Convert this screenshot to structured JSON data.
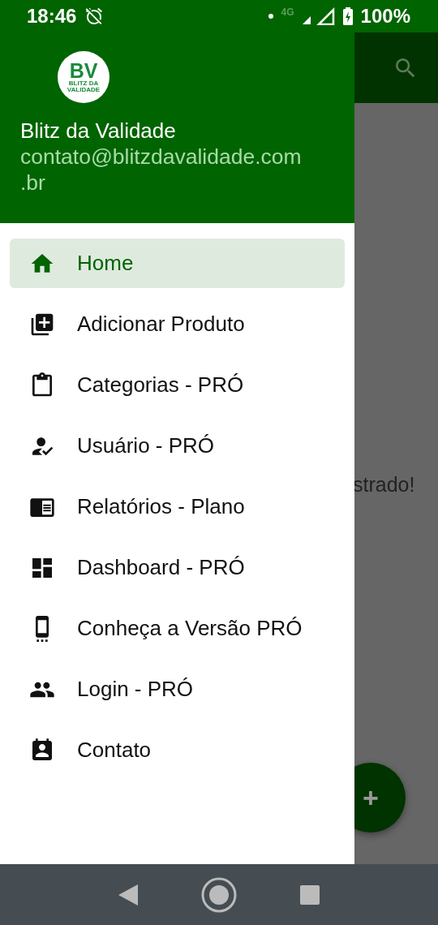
{
  "status_bar": {
    "time": "18:46",
    "network": "4G",
    "battery": "100%"
  },
  "drawer": {
    "logo": {
      "letters": "BV",
      "tagline": "BLITZ DA VALIDADE"
    },
    "title": "Blitz da Validade",
    "email": "contato@blitzdavalidade.com.br",
    "items": [
      {
        "label": "Home",
        "selected": true
      },
      {
        "label": "Adicionar Produto",
        "selected": false
      },
      {
        "label": "Categorias - PRÓ",
        "selected": false
      },
      {
        "label": "Usuário - PRÓ",
        "selected": false
      },
      {
        "label": "Relatórios - Plano",
        "selected": false
      },
      {
        "label": "Dashboard - PRÓ",
        "selected": false
      },
      {
        "label": "Conheça a Versão PRÓ",
        "selected": false
      },
      {
        "label": "Login - PRÓ",
        "selected": false
      },
      {
        "label": "Contato",
        "selected": false
      }
    ]
  },
  "background": {
    "message": "strado!",
    "fab": "+"
  }
}
